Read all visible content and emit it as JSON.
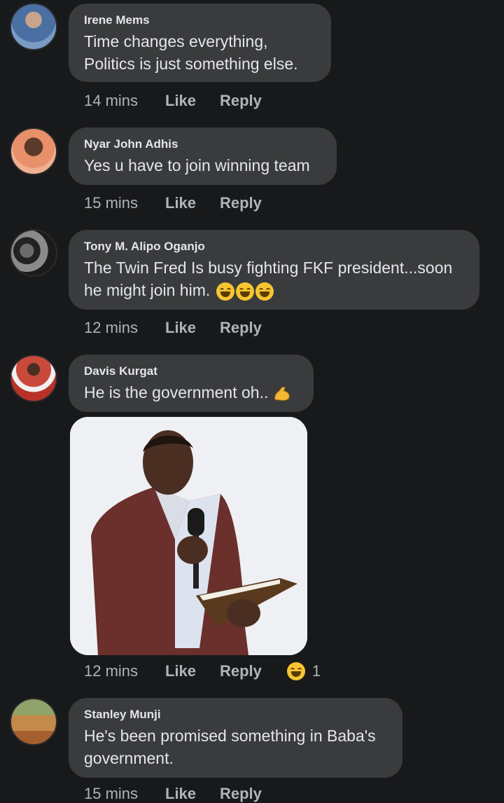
{
  "comments": [
    {
      "author": "Irene Mems",
      "text": "Time changes everything,\nPolitics is just something else.",
      "time": "14 mins"
    },
    {
      "author": "Nyar John Adhis",
      "text": "Yes u have to join winning team",
      "time": "15 mins"
    },
    {
      "author": "Tony M. Alipo Oganjo",
      "text": "The Twin Fred Is busy fighting FKF president...soon\nhe might join him.",
      "time": "12 mins"
    },
    {
      "author": "Davis Kurgat",
      "text": "He is the government oh..",
      "time": "12 mins",
      "reaction_count": "1"
    },
    {
      "author": "Stanley Munji",
      "text": "He's been promised something in Baba's\ngovernment.",
      "time": "15 mins"
    }
  ],
  "actions": {
    "like": "Like",
    "reply": "Reply"
  },
  "icons": {
    "laugh": "tears-of-joy-icon",
    "muscle": "flexed-biceps-icon",
    "reaction": "grinning-sweat-icon"
  },
  "colors": {
    "background": "#18191a",
    "bubble": "#3a3b3c",
    "meta_text": "#b0b3b8"
  }
}
